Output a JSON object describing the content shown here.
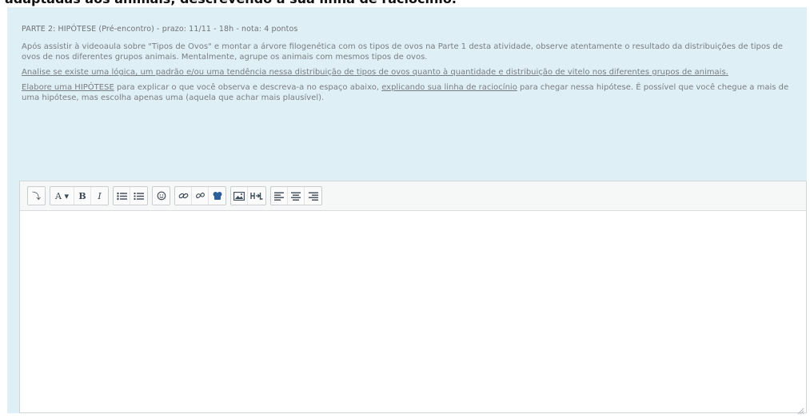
{
  "top_heading": "adaptadas aos animais, descrevendo a sua linha de raciocínio.",
  "part": {
    "title": "PARTE 2: HIPÓTESE (Pré-encontro) - prazo: 11/11 - 18h - nota: 4 pontos"
  },
  "paragraphs": {
    "p1": "Após assistir à videoaula sobre \"Tipos de Ovos\" e montar a árvore filogenética com os tipos de ovos na Parte 1 desta atividade, observe atentamente o resultado da distribuições de tipos de ovos de nos diferentes grupos animais. Mentalmente, agrupe os animais com mesmos tipos de ovos.",
    "p2": "Analise se existe uma lógica, um padrão e/ou uma tendência nessa distribuição de tipos de ovos quanto à quantidade e distribuição de vitelo nos diferentes grupos de animais.",
    "p3_link1": "Elabore uma HIPÓTESE",
    "p3_text1": " para explicar o que você observa e descreva-a no espaço abaixo, ",
    "p3_link2": "explicando sua linha de raciocínio",
    "p3_text2": " para chegar nessa hipótese. É possível que você chegue a mais de uma hipótese, mas escolha apenas uma (aquela que achar mais plausível)."
  },
  "toolbar": {
    "expand_label": "⤵",
    "font_label": "A ▾",
    "bold_label": "B",
    "italic_label": "I"
  },
  "editor": {
    "value": ""
  },
  "icons": [
    "collapse-icon",
    "font-color-icon",
    "bold-icon",
    "italic-icon",
    "unordered-list-icon",
    "ordered-list-icon",
    "emoticon-icon",
    "link-icon",
    "unlink-icon",
    "media-icon",
    "image-icon",
    "equation-icon",
    "align-left-icon",
    "align-center-icon",
    "align-right-icon"
  ]
}
